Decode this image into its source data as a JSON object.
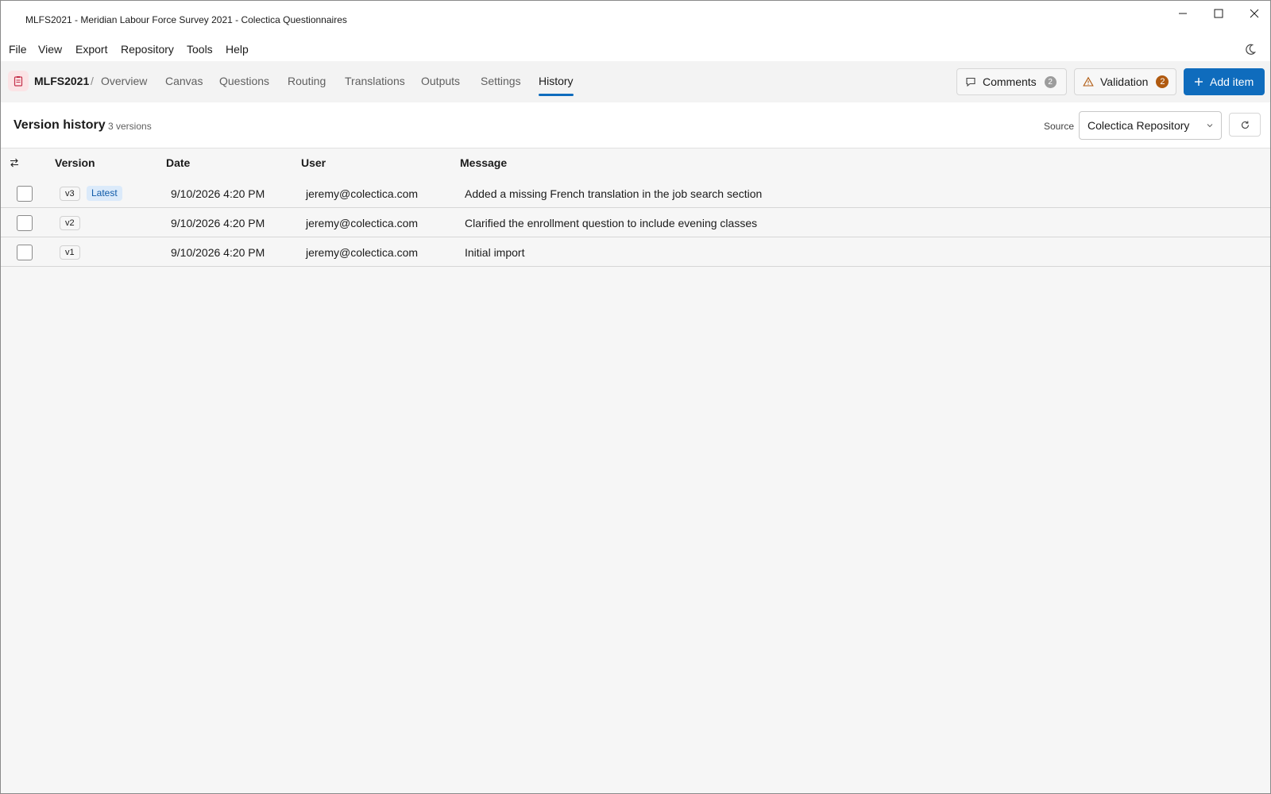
{
  "window": {
    "title": "MLFS2021 - Meridian Labour Force Survey 2021 - Colectica Questionnaires"
  },
  "menu": {
    "items": [
      "File",
      "View",
      "Export",
      "Repository",
      "Tools",
      "Help"
    ]
  },
  "nav": {
    "doc_name": "MLFS2021",
    "separator": "/",
    "tabs": [
      "Overview",
      "Canvas",
      "Questions",
      "Routing",
      "Translations",
      "Outputs",
      "Settings",
      "History"
    ],
    "active_tab": "History",
    "comments_label": "Comments",
    "comments_count": "2",
    "validation_label": "Validation",
    "validation_count": "2",
    "add_label": "Add item",
    "accent": "#0f6cbd",
    "warning_color": "#b05a10"
  },
  "header": {
    "title": "Version history",
    "subtitle": "3 versions",
    "source_label": "Source",
    "source_value": "Colectica Repository"
  },
  "table": {
    "columns": [
      "Version",
      "Date",
      "User",
      "Message"
    ],
    "rows": [
      {
        "version": "v3",
        "latest": "Latest",
        "date": "9/10/2026 4:20 PM",
        "user": "jeremy@colectica.com",
        "message": "Added a missing French translation in the job search section"
      },
      {
        "version": "v2",
        "date": "9/10/2026 4:20 PM",
        "user": "jeremy@colectica.com",
        "message": "Clarified the enrollment question to include evening classes"
      },
      {
        "version": "v1",
        "date": "9/10/2026 4:20 PM",
        "user": "jeremy@colectica.com",
        "message": "Initial import"
      }
    ]
  }
}
